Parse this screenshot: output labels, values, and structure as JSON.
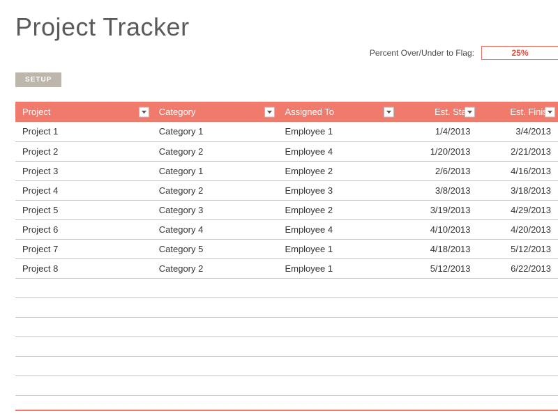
{
  "title": "Project Tracker",
  "flag": {
    "label": "Percent Over/Under to Flag:",
    "value": "25%"
  },
  "setup_label": "SETUP",
  "columns": [
    {
      "key": "project",
      "label": "Project",
      "align": "left"
    },
    {
      "key": "category",
      "label": "Category",
      "align": "left"
    },
    {
      "key": "assigned",
      "label": "Assigned To",
      "align": "left"
    },
    {
      "key": "est_start",
      "label": "Est. Start",
      "align": "right"
    },
    {
      "key": "est_finish",
      "label": "Est. Finish",
      "align": "right"
    }
  ],
  "rows": [
    {
      "project": "Project 1",
      "category": "Category 1",
      "assigned": "Employee 1",
      "est_start": "1/4/2013",
      "est_finish": "3/4/2013"
    },
    {
      "project": "Project 2",
      "category": "Category 2",
      "assigned": "Employee 4",
      "est_start": "1/20/2013",
      "est_finish": "2/21/2013"
    },
    {
      "project": "Project 3",
      "category": "Category 1",
      "assigned": "Employee 2",
      "est_start": "2/6/2013",
      "est_finish": "4/16/2013"
    },
    {
      "project": "Project 4",
      "category": "Category 2",
      "assigned": "Employee 3",
      "est_start": "3/8/2013",
      "est_finish": "3/18/2013"
    },
    {
      "project": "Project 5",
      "category": "Category 3",
      "assigned": "Employee 2",
      "est_start": "3/19/2013",
      "est_finish": "4/29/2013"
    },
    {
      "project": "Project 6",
      "category": "Category 4",
      "assigned": "Employee 4",
      "est_start": "4/10/2013",
      "est_finish": "4/20/2013"
    },
    {
      "project": "Project 7",
      "category": "Category 5",
      "assigned": "Employee 1",
      "est_start": "4/18/2013",
      "est_finish": "5/12/2013"
    },
    {
      "project": "Project 8",
      "category": "Category 2",
      "assigned": "Employee 1",
      "est_start": "5/12/2013",
      "est_finish": "6/22/2013"
    }
  ],
  "empty_rows": 6
}
